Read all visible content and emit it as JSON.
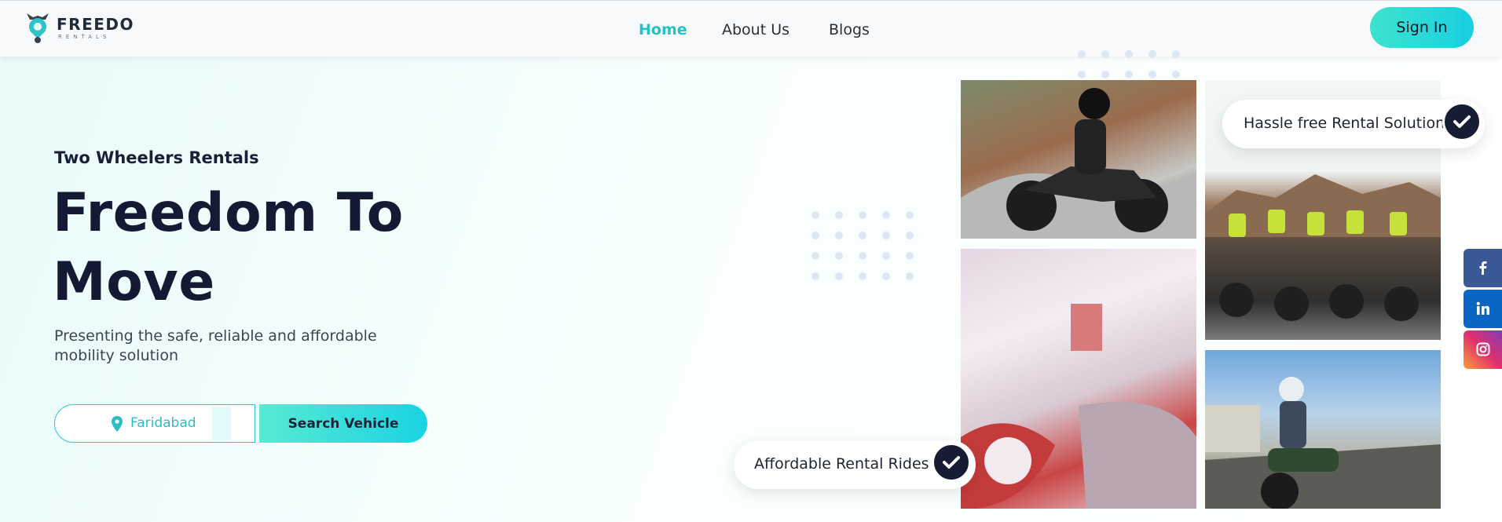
{
  "header": {
    "logo": {
      "name": "FREEDO",
      "sub": "RENTALS"
    },
    "nav": [
      {
        "label": "Home",
        "active": true
      },
      {
        "label": "About Us",
        "active": false
      },
      {
        "label": "Blogs",
        "active": false
      }
    ],
    "signin_label": "Sign In"
  },
  "hero": {
    "kicker": "Two Wheelers Rentals",
    "title_line1": "Freedom To",
    "title_line2": "Move",
    "description": "Presenting the safe, reliable and affordable mobility solution",
    "search": {
      "location_value": "Faridabad",
      "button_label": "Search Vehicle"
    }
  },
  "badges": {
    "top": "Hassle free Rental Solution",
    "bottom": "Affordable Rental Rides"
  },
  "social": [
    {
      "name": "facebook",
      "icon": "facebook-icon"
    },
    {
      "name": "linkedin",
      "icon": "linkedin-icon"
    },
    {
      "name": "instagram",
      "icon": "instagram-icon"
    }
  ],
  "colors": {
    "accent": "#21c1c8",
    "button_gradient_start": "#3ee3cf",
    "button_gradient_end": "#18cfe0",
    "dark": "#151c33"
  }
}
